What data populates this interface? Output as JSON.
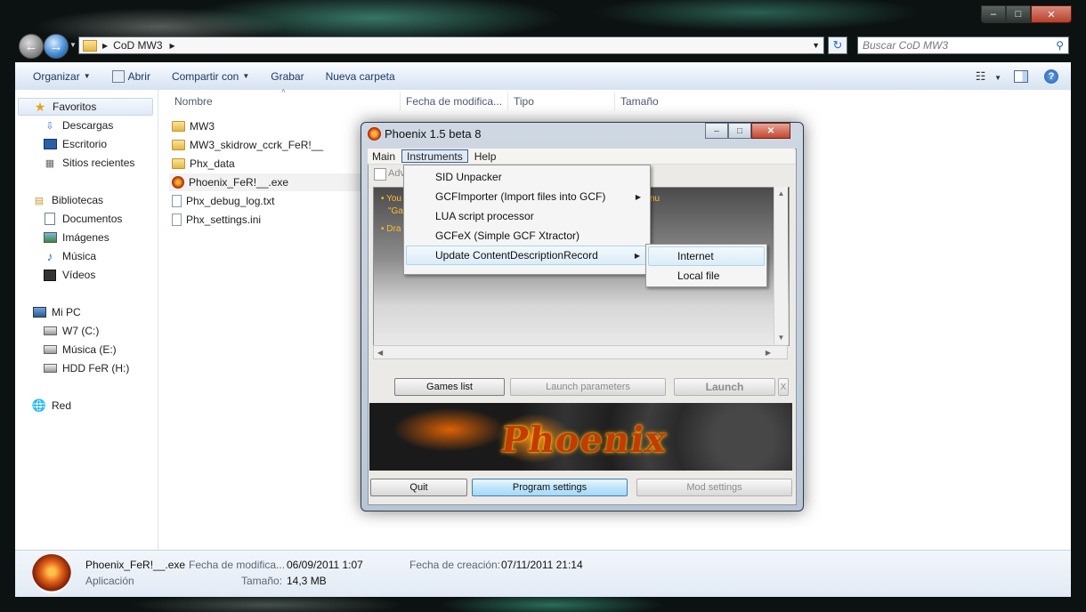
{
  "explorer": {
    "address_path": "CoD MW3",
    "search_placeholder": "Buscar CoD MW3",
    "toolbar": {
      "organize": "Organizar",
      "open": "Abrir",
      "share": "Compartir con",
      "burn": "Grabar",
      "new_folder": "Nueva carpeta"
    },
    "nav": {
      "favorites": "Favoritos",
      "downloads": "Descargas",
      "desktop": "Escritorio",
      "recent": "Sitios recientes",
      "libraries": "Bibliotecas",
      "documents": "Documentos",
      "images": "Imágenes",
      "music": "Música",
      "videos": "Vídeos",
      "computer": "Mi PC",
      "drive_c": "W7 (C:)",
      "drive_e": "Música (E:)",
      "drive_h": "HDD FeR (H:)",
      "network": "Red"
    },
    "columns": {
      "name": "Nombre",
      "modified": "Fecha de modifica...",
      "type": "Tipo",
      "size": "Tamaño"
    },
    "files": [
      {
        "name": "MW3",
        "kind": "folder"
      },
      {
        "name": "MW3_skidrow_ccrk_FeR!__",
        "kind": "folder"
      },
      {
        "name": "Phx_data",
        "kind": "folder"
      },
      {
        "name": "Phoenix_FeR!__.exe",
        "kind": "exe"
      },
      {
        "name": "Phx_debug_log.txt",
        "kind": "file"
      },
      {
        "name": "Phx_settings.ini",
        "kind": "file"
      }
    ],
    "details": {
      "filename": "Phoenix_FeR!__.exe",
      "type": "Aplicación",
      "modified_label": "Fecha de modifica...",
      "modified_value": "06/09/2011 1:07",
      "size_label": "Tamaño:",
      "size_value": "14,3 MB",
      "created_label": "Fecha de creación:",
      "created_value": "07/11/2011 21:14"
    }
  },
  "phoenix": {
    "title": "Phoenix 1.5 beta 8",
    "menubar": [
      "Main",
      "Instruments",
      "Help"
    ],
    "checkbox_label": "Adv",
    "log_lines": [
      "• You",
      "\"Ga",
      "• Dra"
    ],
    "log_tail": "nu",
    "instruments_menu": [
      "SID Unpacker",
      "GCFImporter (Import files into GCF)",
      "LUA script processor",
      "GCFeX (Simple GCF Xtractor)",
      "Update ContentDescriptionRecord"
    ],
    "update_submenu": [
      "Internet",
      "Local file"
    ],
    "buttons": {
      "games_list": "Games list",
      "launch_params": "Launch parameters",
      "launch": "Launch",
      "x": "X",
      "quit": "Quit",
      "program_settings": "Program settings",
      "mod_settings": "Mod settings"
    },
    "banner_text": "Phoenix"
  }
}
